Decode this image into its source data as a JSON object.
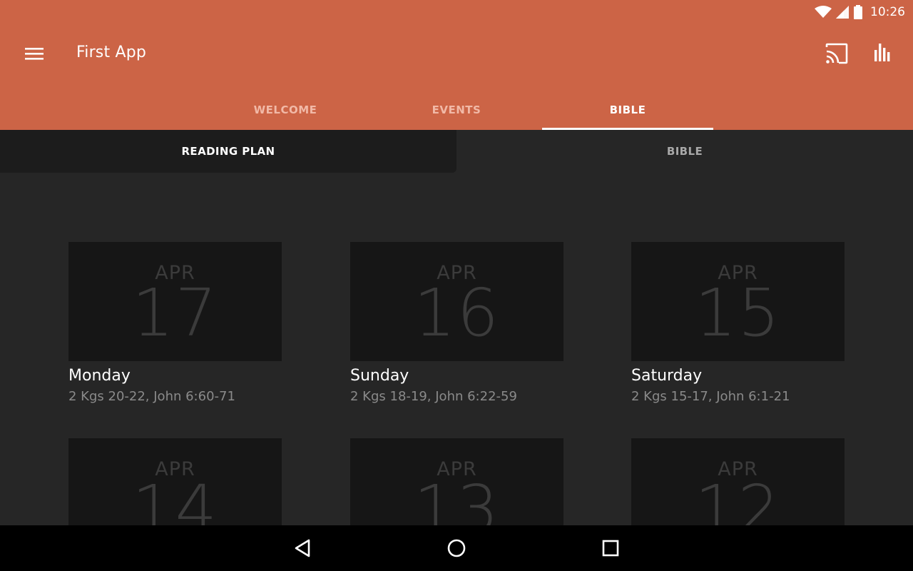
{
  "status_bar": {
    "time": "10:26"
  },
  "app_bar": {
    "title": "First App",
    "tabs": [
      {
        "label": "WELCOME",
        "active": false
      },
      {
        "label": "EVENTS",
        "active": false
      },
      {
        "label": "BIBLE",
        "active": true
      }
    ]
  },
  "sub_tabs": [
    {
      "label": "READING PLAN",
      "active": true
    },
    {
      "label": "BIBLE",
      "active": false
    }
  ],
  "reading_plan": [
    {
      "month": "APR",
      "day": "17",
      "weekday": "Monday",
      "refs": "2 Kgs 20-22, John 6:60-71"
    },
    {
      "month": "APR",
      "day": "16",
      "weekday": "Sunday",
      "refs": "2 Kgs 18-19, John 6:22-59"
    },
    {
      "month": "APR",
      "day": "15",
      "weekday": "Saturday",
      "refs": "2 Kgs 15-17, John 6:1-21"
    },
    {
      "month": "APR",
      "day": "14"
    },
    {
      "month": "APR",
      "day": "13"
    },
    {
      "month": "APR",
      "day": "12"
    }
  ],
  "icons": {
    "menu": "hamburger-menu-icon",
    "cast": "cast-icon",
    "stats": "bar-chart-icon",
    "wifi": "wifi-icon",
    "signal": "cell-signal-icon",
    "battery": "battery-icon",
    "back": "back-triangle-icon",
    "home": "home-circle-icon",
    "recents": "recents-square-icon"
  },
  "colors": {
    "accent": "#cc6446",
    "background": "#262626",
    "card": "#161616",
    "nav": "#000000"
  }
}
